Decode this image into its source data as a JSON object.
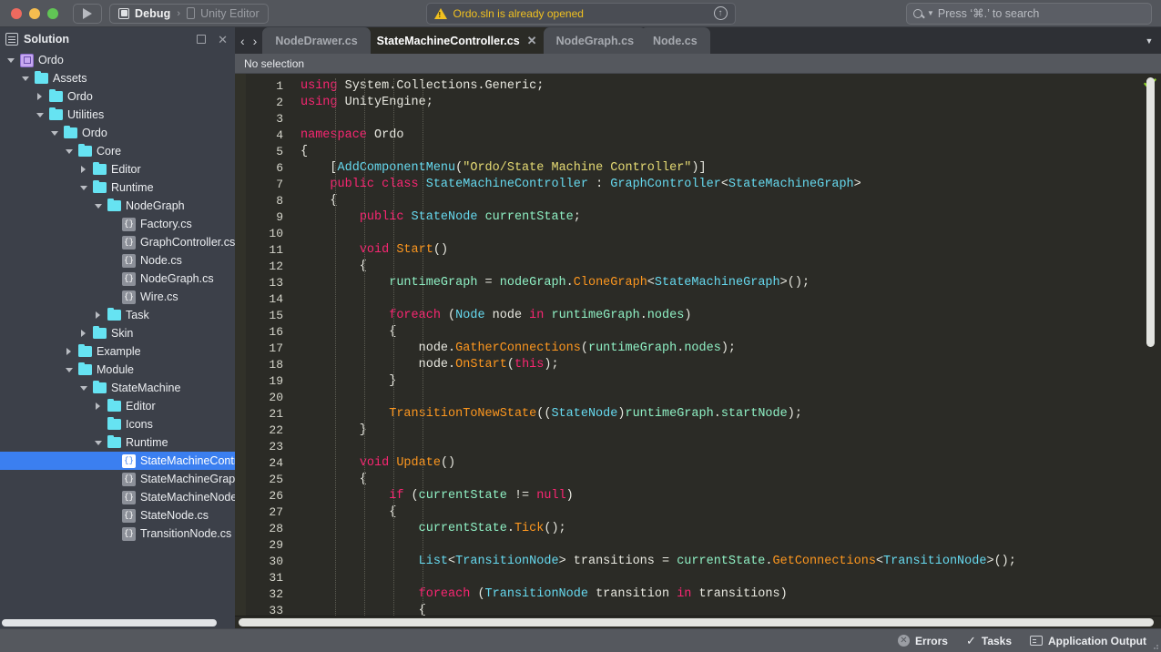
{
  "toolbar": {
    "run_button_icon": "play-icon",
    "config_icon": "device-square-icon",
    "config_label": "Debug",
    "separator": "›",
    "device_icon": "mobile-device-icon",
    "device_label": "Unity Editor",
    "notification": {
      "icon": "warning-triangle-icon",
      "text": "Ordo.sln is already opened",
      "action_icon": "arrow-up-circle-icon"
    },
    "search": {
      "icon": "search-icon",
      "dropdown_icon": "chevron-down-icon",
      "placeholder": "Press ‘⌘.’ to search"
    }
  },
  "sidebar": {
    "header": {
      "icon": "solution-pad-icon",
      "title": "Solution",
      "minimize_icon": "minimize-icon",
      "close_icon": "close-icon"
    },
    "tree": [
      {
        "label": "Ordo",
        "depth": 0,
        "icon": "solution-icon",
        "twisty": "open",
        "selected": false
      },
      {
        "label": "Assets",
        "depth": 1,
        "icon": "folder-icon",
        "twisty": "open",
        "selected": false
      },
      {
        "label": "Ordo",
        "depth": 2,
        "icon": "folder-icon",
        "twisty": "closed",
        "selected": false
      },
      {
        "label": "Utilities",
        "depth": 2,
        "icon": "folder-icon",
        "twisty": "open",
        "selected": false
      },
      {
        "label": "Ordo",
        "depth": 3,
        "icon": "folder-icon",
        "twisty": "open",
        "selected": false
      },
      {
        "label": "Core",
        "depth": 4,
        "icon": "folder-icon",
        "twisty": "open",
        "selected": false
      },
      {
        "label": "Editor",
        "depth": 5,
        "icon": "folder-icon",
        "twisty": "closed",
        "selected": false
      },
      {
        "label": "Runtime",
        "depth": 5,
        "icon": "folder-icon",
        "twisty": "open",
        "selected": false
      },
      {
        "label": "NodeGraph",
        "depth": 6,
        "icon": "folder-icon",
        "twisty": "open",
        "selected": false
      },
      {
        "label": "Factory.cs",
        "depth": 7,
        "icon": "csharp-file-icon",
        "twisty": "none",
        "selected": false
      },
      {
        "label": "GraphController.cs",
        "depth": 7,
        "icon": "csharp-file-icon",
        "twisty": "none",
        "selected": false
      },
      {
        "label": "Node.cs",
        "depth": 7,
        "icon": "csharp-file-icon",
        "twisty": "none",
        "selected": false
      },
      {
        "label": "NodeGraph.cs",
        "depth": 7,
        "icon": "csharp-file-icon",
        "twisty": "none",
        "selected": false
      },
      {
        "label": "Wire.cs",
        "depth": 7,
        "icon": "csharp-file-icon",
        "twisty": "none",
        "selected": false
      },
      {
        "label": "Task",
        "depth": 6,
        "icon": "folder-icon",
        "twisty": "closed",
        "selected": false
      },
      {
        "label": "Skin",
        "depth": 5,
        "icon": "folder-icon",
        "twisty": "closed",
        "selected": false
      },
      {
        "label": "Example",
        "depth": 4,
        "icon": "folder-icon",
        "twisty": "closed",
        "selected": false
      },
      {
        "label": "Module",
        "depth": 4,
        "icon": "folder-icon",
        "twisty": "open",
        "selected": false
      },
      {
        "label": "StateMachine",
        "depth": 5,
        "icon": "folder-icon",
        "twisty": "open",
        "selected": false
      },
      {
        "label": "Editor",
        "depth": 6,
        "icon": "folder-icon",
        "twisty": "closed",
        "selected": false
      },
      {
        "label": "Icons",
        "depth": 6,
        "icon": "folder-icon",
        "twisty": "none",
        "selected": false
      },
      {
        "label": "Runtime",
        "depth": 6,
        "icon": "folder-icon",
        "twisty": "open",
        "selected": false
      },
      {
        "label": "StateMachineController.cs",
        "depth": 7,
        "icon": "csharp-file-icon",
        "twisty": "none",
        "selected": true
      },
      {
        "label": "StateMachineGraph.cs",
        "depth": 7,
        "icon": "csharp-file-icon",
        "twisty": "none",
        "selected": false
      },
      {
        "label": "StateMachineNode.cs",
        "depth": 7,
        "icon": "csharp-file-icon",
        "twisty": "none",
        "selected": false
      },
      {
        "label": "StateNode.cs",
        "depth": 7,
        "icon": "csharp-file-icon",
        "twisty": "none",
        "selected": false
      },
      {
        "label": "TransitionNode.cs",
        "depth": 7,
        "icon": "csharp-file-icon",
        "twisty": "none",
        "selected": false
      }
    ]
  },
  "editor": {
    "nav_back_icon": "chevron-left-icon",
    "nav_forward_icon": "chevron-right-icon",
    "tabs": [
      {
        "label": "NodeDrawer.cs",
        "active": false,
        "closable": false
      },
      {
        "label": "StateMachineController.cs",
        "active": true,
        "closable": true
      },
      {
        "label": "NodeGraph.cs",
        "active": false,
        "closable": false
      },
      {
        "label": "Node.cs",
        "active": false,
        "closable": false
      }
    ],
    "tab_overflow_icon": "chevron-down-icon",
    "breadcrumb": "No selection",
    "status_check_icon": "check-ok-icon",
    "first_line": 1,
    "last_line": 33,
    "code_lines": [
      [
        {
          "t": "using ",
          "c": "k"
        },
        {
          "t": "System.Collections.Generic;",
          "c": "p"
        }
      ],
      [
        {
          "t": "using ",
          "c": "k"
        },
        {
          "t": "UnityEngine;",
          "c": "p"
        }
      ],
      [],
      [
        {
          "t": "namespace ",
          "c": "k"
        },
        {
          "t": "Ordo",
          "c": "p"
        }
      ],
      [
        {
          "t": "{",
          "c": "p"
        }
      ],
      [
        {
          "t": "    [",
          "c": "p"
        },
        {
          "t": "AddComponentMenu",
          "c": "a"
        },
        {
          "t": "(",
          "c": "p"
        },
        {
          "t": "\"Ordo/State Machine Controller\"",
          "c": "s"
        },
        {
          "t": ")]",
          "c": "p"
        }
      ],
      [
        {
          "t": "    ",
          "c": "p"
        },
        {
          "t": "public class ",
          "c": "k"
        },
        {
          "t": "StateMachineController",
          "c": "t"
        },
        {
          "t": " : ",
          "c": "p"
        },
        {
          "t": "GraphController",
          "c": "t"
        },
        {
          "t": "<",
          "c": "p"
        },
        {
          "t": "StateMachineGraph",
          "c": "t"
        },
        {
          "t": ">",
          "c": "p"
        }
      ],
      [
        {
          "t": "    {",
          "c": "p"
        }
      ],
      [
        {
          "t": "        ",
          "c": "p"
        },
        {
          "t": "public ",
          "c": "k"
        },
        {
          "t": "StateNode",
          "c": "t"
        },
        {
          "t": " ",
          "c": "p"
        },
        {
          "t": "currentState",
          "c": "v"
        },
        {
          "t": ";",
          "c": "p"
        }
      ],
      [],
      [
        {
          "t": "        ",
          "c": "p"
        },
        {
          "t": "void ",
          "c": "k"
        },
        {
          "t": "Start",
          "c": "m"
        },
        {
          "t": "()",
          "c": "p"
        }
      ],
      [
        {
          "t": "        {",
          "c": "p"
        }
      ],
      [
        {
          "t": "            ",
          "c": "p"
        },
        {
          "t": "runtimeGraph",
          "c": "v"
        },
        {
          "t": " = ",
          "c": "p"
        },
        {
          "t": "nodeGraph",
          "c": "v"
        },
        {
          "t": ".",
          "c": "p"
        },
        {
          "t": "CloneGraph",
          "c": "m"
        },
        {
          "t": "<",
          "c": "p"
        },
        {
          "t": "StateMachineGraph",
          "c": "t"
        },
        {
          "t": ">();",
          "c": "p"
        }
      ],
      [],
      [
        {
          "t": "            ",
          "c": "p"
        },
        {
          "t": "foreach ",
          "c": "k"
        },
        {
          "t": "(",
          "c": "p"
        },
        {
          "t": "Node",
          "c": "t"
        },
        {
          "t": " node ",
          "c": "p"
        },
        {
          "t": "in ",
          "c": "k"
        },
        {
          "t": "runtimeGraph",
          "c": "v"
        },
        {
          "t": ".",
          "c": "p"
        },
        {
          "t": "nodes",
          "c": "v"
        },
        {
          "t": ")",
          "c": "p"
        }
      ],
      [
        {
          "t": "            {",
          "c": "p"
        }
      ],
      [
        {
          "t": "                node.",
          "c": "p"
        },
        {
          "t": "GatherConnections",
          "c": "m"
        },
        {
          "t": "(",
          "c": "p"
        },
        {
          "t": "runtimeGraph",
          "c": "v"
        },
        {
          "t": ".",
          "c": "p"
        },
        {
          "t": "nodes",
          "c": "v"
        },
        {
          "t": ");",
          "c": "p"
        }
      ],
      [
        {
          "t": "                node.",
          "c": "p"
        },
        {
          "t": "OnStart",
          "c": "m"
        },
        {
          "t": "(",
          "c": "p"
        },
        {
          "t": "this",
          "c": "k"
        },
        {
          "t": ");",
          "c": "p"
        }
      ],
      [
        {
          "t": "            }",
          "c": "p"
        }
      ],
      [],
      [
        {
          "t": "            ",
          "c": "p"
        },
        {
          "t": "TransitionToNewState",
          "c": "m"
        },
        {
          "t": "((",
          "c": "p"
        },
        {
          "t": "StateNode",
          "c": "t"
        },
        {
          "t": ")",
          "c": "p"
        },
        {
          "t": "runtimeGraph",
          "c": "v"
        },
        {
          "t": ".",
          "c": "p"
        },
        {
          "t": "startNode",
          "c": "v"
        },
        {
          "t": ");",
          "c": "p"
        }
      ],
      [
        {
          "t": "        }",
          "c": "p"
        }
      ],
      [],
      [
        {
          "t": "        ",
          "c": "p"
        },
        {
          "t": "void ",
          "c": "k"
        },
        {
          "t": "Update",
          "c": "m"
        },
        {
          "t": "()",
          "c": "p"
        }
      ],
      [
        {
          "t": "        {",
          "c": "p"
        }
      ],
      [
        {
          "t": "            ",
          "c": "p"
        },
        {
          "t": "if ",
          "c": "k"
        },
        {
          "t": "(",
          "c": "p"
        },
        {
          "t": "currentState",
          "c": "v"
        },
        {
          "t": " != ",
          "c": "p"
        },
        {
          "t": "null",
          "c": "k"
        },
        {
          "t": ")",
          "c": "p"
        }
      ],
      [
        {
          "t": "            {",
          "c": "p"
        }
      ],
      [
        {
          "t": "                ",
          "c": "p"
        },
        {
          "t": "currentState",
          "c": "v"
        },
        {
          "t": ".",
          "c": "p"
        },
        {
          "t": "Tick",
          "c": "m"
        },
        {
          "t": "();",
          "c": "p"
        }
      ],
      [],
      [
        {
          "t": "                ",
          "c": "p"
        },
        {
          "t": "List",
          "c": "t"
        },
        {
          "t": "<",
          "c": "p"
        },
        {
          "t": "TransitionNode",
          "c": "t"
        },
        {
          "t": "> transitions = ",
          "c": "p"
        },
        {
          "t": "currentState",
          "c": "v"
        },
        {
          "t": ".",
          "c": "p"
        },
        {
          "t": "GetConnections",
          "c": "m"
        },
        {
          "t": "<",
          "c": "p"
        },
        {
          "t": "TransitionNode",
          "c": "t"
        },
        {
          "t": ">();",
          "c": "p"
        }
      ],
      [],
      [
        {
          "t": "                ",
          "c": "p"
        },
        {
          "t": "foreach ",
          "c": "k"
        },
        {
          "t": "(",
          "c": "p"
        },
        {
          "t": "TransitionNode",
          "c": "t"
        },
        {
          "t": " transition ",
          "c": "p"
        },
        {
          "t": "in ",
          "c": "k"
        },
        {
          "t": "transitions",
          "c": "p"
        },
        {
          "t": ")",
          "c": "p"
        }
      ],
      [
        {
          "t": "                {",
          "c": "p"
        }
      ]
    ]
  },
  "statusbar": {
    "items": [
      {
        "icon": "error-circle-icon",
        "label": "Errors"
      },
      {
        "icon": "check-icon",
        "label": "Tasks"
      },
      {
        "icon": "application-output-icon",
        "label": "Application Output"
      }
    ]
  },
  "colors": {
    "accent_selection": "#3b7ff0",
    "warning": "#f0c020",
    "folder": "#66e3f2",
    "editor_bg": "#2b2b26",
    "keyword": "#f92672",
    "type": "#66d9ef",
    "method": "#fd971f",
    "string": "#e6db74",
    "variable": "#8ff0c4"
  }
}
